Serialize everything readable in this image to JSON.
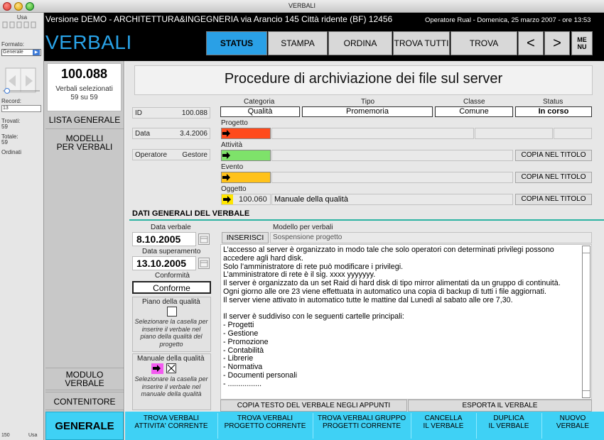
{
  "window": {
    "title": "VERBALI"
  },
  "status_area": {
    "user": "Usa",
    "formato_label": "Formato:",
    "formato_value": "Generale",
    "record_label": "Record:",
    "record_value": "13",
    "trovati_label": "Trovati:",
    "trovati_value": "59",
    "totale_label": "Totale:",
    "totale_value": "59",
    "ordinati_label": "Ordinati",
    "zoom": "150",
    "mode": "Usa"
  },
  "header": {
    "demo_line": "Versione DEMO - ARCHITETTURA&INGEGNERIA via Arancio 145 Città ridente (BF) 12456",
    "operator_line": "Operatore Rual - Domenica, 25 marzo 2007 - ore 13:53",
    "app_title": "VERBALI",
    "nav": {
      "status": "STATUS",
      "stampa": "STAMPA",
      "ordina": "ORDINA",
      "trova_tutti": "TROVA TUTTI",
      "trova": "TROVA",
      "prev": "<",
      "next": ">",
      "menu_line1": "ME",
      "menu_line2": "NU"
    }
  },
  "left_nav": {
    "count": "100.088",
    "selected_line1": "Verbali selezionati",
    "selected_line2": "59 su 59",
    "lista_generale": "LISTA GENERALE",
    "modelli_line1": "MODELLI",
    "modelli_line2": "PER VERBALI",
    "modulo_line1": "MODULO",
    "modulo_line2": "VERBALE",
    "contenitore": "CONTENITORE",
    "generale": "GENERALE"
  },
  "record": {
    "page_title": "Procedure di archiviazione dei file sul server",
    "id_label": "ID",
    "id_value": "100.088",
    "data_label": "Data",
    "data_value": "3.4.2006",
    "operatore_label": "Operatore",
    "operatore_value": "Gestore",
    "categoria_label": "Categoria",
    "categoria_value": "Qualità",
    "tipo_label": "Tipo",
    "tipo_value": "Promemoria",
    "classe_label": "Classe",
    "classe_value": "Comune",
    "status_label": "Status",
    "status_value": "In corso",
    "progetto_label": "Progetto",
    "attivita_label": "Attività",
    "evento_label": "Evento",
    "oggetto_label": "Oggetto",
    "oggetto_code": "100.060",
    "oggetto_value": "Manuale della qualità",
    "copy_title": "COPIA NEL TITOLO",
    "colors": {
      "progetto": "#ff4a1c",
      "attivita": "#7ee26a",
      "evento": "#ffc21a",
      "arrow": "#ffe600"
    }
  },
  "section": {
    "title": "DATI GENERALI DEL VERBALE",
    "data_verbale_label": "Data verbale",
    "data_verbale_value": "8.10.2005",
    "data_superamento_label": "Data superamento",
    "data_superamento_value": "13.10.2005",
    "conformita_label": "Conformità",
    "conformita_value": "Conforme",
    "piano_label": "Piano della qualità",
    "piano_hint": "Selezionare la casella per inserire il verbale nel piano della qualità del progetto",
    "manuale_label": "Manuale della qualità",
    "manuale_hint": "Selezionare la casella per inserire il verbale nel manuale della qualità",
    "modello_label": "Modello per verbali",
    "inserisci": "INSERISCI",
    "modello_value": "Sospensione progetto",
    "body_text": "L’accesso al server è organizzato in modo tale che solo operatori con determinati privilegi possono accedere agli hard disk.\nSolo l’amministratore di rete può modificare i privilegi.\nL’amministratore di rete è il sig. xxxx yyyyyyy.\nIl server è organizzato da un set Raid di hard disk di tipo mirror alimentati da un gruppo di continuità.\nOgni giorno alle ore 23 viene effettuata in automatico una copia di backup di tutti i file aggiornati.\nIl server viene attivato in automatico tutte le mattine dal Lunedì al sabato alle ore 7,30.\n\nIl server è suddiviso con le seguenti cartelle principali:\n- Progetti\n- Gestione\n- Promozione\n- Contabilità\n- Librerie\n- Normativa\n- Documenti personali\n- ................",
    "copia_testo": "COPIA TESTO DEL VERBALE NEGLI APPUNTI",
    "esporta": "ESPORTA IL VERBALE"
  },
  "bottom_bar": {
    "b1_l1": "TROVA VERBALI",
    "b1_l2": "ATTIVITA' CORRENTE",
    "b2_l1": "TROVA VERBALI",
    "b2_l2": "PROGETTO CORRENTE",
    "b3_l1": "TROVA VERBALI GRUPPO",
    "b3_l2": "PROGETTI CORRENTE",
    "b4_l1": "CANCELLA",
    "b4_l2": "IL VERBALE",
    "b5_l1": "DUPLICA",
    "b5_l2": "IL VERBALE",
    "b6_l1": "NUOVO",
    "b6_l2": "VERBALE"
  }
}
